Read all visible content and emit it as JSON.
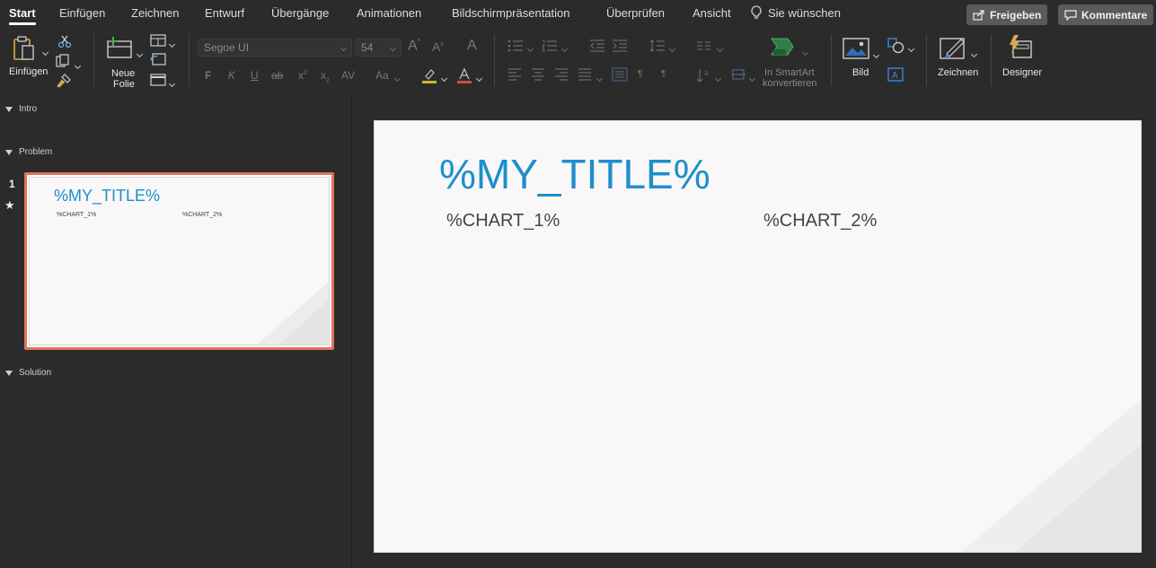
{
  "tabs": [
    "Start",
    "Einfügen",
    "Zeichnen",
    "Entwurf",
    "Übergänge",
    "Animationen",
    "Bildschirmpräsentation",
    "Überprüfen",
    "Ansicht"
  ],
  "tell_me": "Sie wünschen",
  "share_button": "Freigeben",
  "comments_button": "Kommentare",
  "ribbon": {
    "paste_label": "Einfügen",
    "new_slide_label_1": "Neue",
    "new_slide_label_2": "Folie",
    "font_name": "Segoe UI",
    "font_size": "54",
    "bold": "F",
    "italic": "K",
    "underline": "U",
    "strike": "ab",
    "case": "Aa",
    "smartart_label_1": "In SmartArt",
    "smartart_label_2": "konvertieren",
    "picture_label": "Bild",
    "draw_label": "Zeichnen",
    "designer_label": "Designer"
  },
  "sections": [
    "Intro",
    "Problem",
    "Solution"
  ],
  "slide_number": "1",
  "slide": {
    "title": "%MY_TITLE%",
    "chart1": "%CHART_1%",
    "chart2": "%CHART_2%"
  },
  "colors": {
    "accent_title": "#1c8fcb",
    "selection_border": "#e0735a",
    "background": "#2b2b2b"
  }
}
